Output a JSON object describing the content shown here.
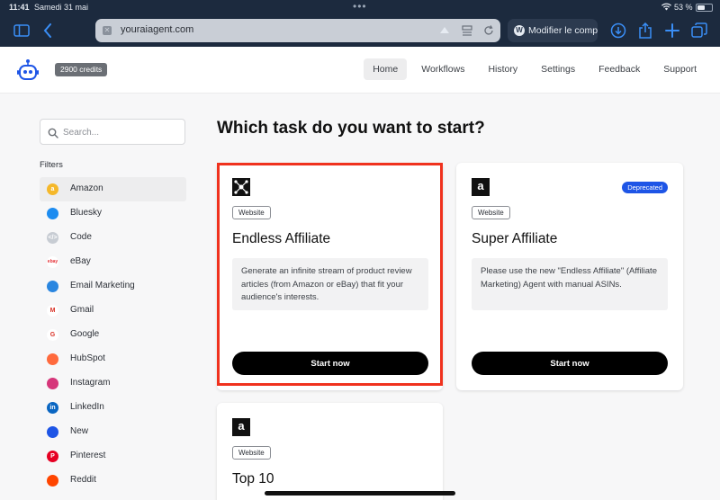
{
  "status_bar": {
    "time": "11:41",
    "date": "Samedi 31 mai",
    "battery": "53 %"
  },
  "browser": {
    "url": "youraiagent.com",
    "tab_title": "Modifier le comp"
  },
  "header": {
    "credits": "2900 credits",
    "nav": [
      "Home",
      "Workflows",
      "History",
      "Settings",
      "Feedback",
      "Support"
    ],
    "active_nav": "Home"
  },
  "sidebar": {
    "search_placeholder": "Search...",
    "filters_title": "Filters",
    "filters": [
      {
        "label": "Amazon",
        "color": "#f5b82a",
        "glyph": "a"
      },
      {
        "label": "Bluesky",
        "color": "#1d8cf0",
        "glyph": ""
      },
      {
        "label": "Code",
        "color": "#c7ccd3",
        "glyph": "</>"
      },
      {
        "label": "eBay",
        "color": "#ffffff",
        "glyph": "ebay"
      },
      {
        "label": "Email Marketing",
        "color": "#2a86e0",
        "glyph": ""
      },
      {
        "label": "Gmail",
        "color": "#ffffff",
        "glyph": "M"
      },
      {
        "label": "Google",
        "color": "#ffffff",
        "glyph": "G"
      },
      {
        "label": "HubSpot",
        "color": "#ff6a3d",
        "glyph": ""
      },
      {
        "label": "Instagram",
        "color": "#d6367a",
        "glyph": ""
      },
      {
        "label": "LinkedIn",
        "color": "#0a66c2",
        "glyph": "in"
      },
      {
        "label": "New",
        "color": "#1e55e6",
        "glyph": ""
      },
      {
        "label": "Pinterest",
        "color": "#e60023",
        "glyph": "P"
      },
      {
        "label": "Reddit",
        "color": "#ff4500",
        "glyph": ""
      }
    ]
  },
  "main": {
    "title": "Which task do you want to start?",
    "cards": [
      {
        "tag": "Website",
        "title": "Endless Affiliate",
        "description": "Generate an infinite stream of product review articles (from Amazon or eBay) that fit your audience's interests.",
        "button": "Start now",
        "badge": ""
      },
      {
        "tag": "Website",
        "title": "Super Affiliate",
        "description": "Please use the new \"Endless Affiliate\" (Affiliate Marketing) Agent with manual ASINs.",
        "button": "Start now",
        "badge": "Deprecated"
      },
      {
        "tag": "Website",
        "title": "Top 10",
        "description": "",
        "button": "",
        "badge": ""
      }
    ]
  },
  "colors": {
    "accent": "#1e55e6",
    "highlight": "#f0321e",
    "toolbar": "#1c2a3e"
  }
}
